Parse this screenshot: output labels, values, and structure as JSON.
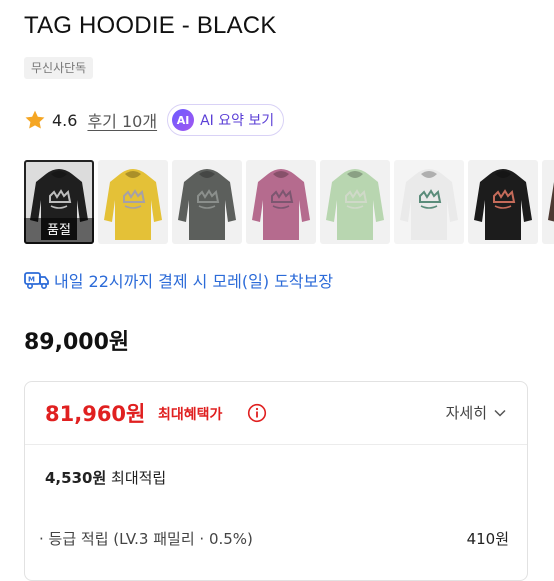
{
  "product": {
    "title": "TAG HOODIE - BLACK",
    "badge": "무신사단독",
    "rating": "4.6",
    "reviews": "후기 10개",
    "ai_badge": "AI",
    "ai_summary": "AI 요약 보기"
  },
  "swatches": [
    {
      "name": "black",
      "color": "#1f1f1f",
      "print": "#bdbdbd",
      "soldout": "품절",
      "bg": "#dcdcdc"
    },
    {
      "name": "yellow",
      "color": "#e4c137",
      "print": "#a5a0a8",
      "bg": "#f1f1f1"
    },
    {
      "name": "charcoal",
      "color": "#5c5f5c",
      "print": "#8b8f8c",
      "bg": "#f1f1f1"
    },
    {
      "name": "mauve",
      "color": "#b56b8e",
      "print": "#7c5670",
      "bg": "#f1f1f1"
    },
    {
      "name": "mint",
      "color": "#b8d6b0",
      "print": "#cfd9c8",
      "bg": "#f1f1f1"
    },
    {
      "name": "white",
      "color": "#eaeaea",
      "print": "#5a8c7a",
      "bg": "#f4f4f4"
    },
    {
      "name": "black-2",
      "color": "#1c1c1c",
      "print": "#c56b5a",
      "bg": "#f1f1f1"
    },
    {
      "name": "brown",
      "color": "#4e3a33",
      "print": "#8a6a5c",
      "bg": "#f1f1f1"
    }
  ],
  "delivery": {
    "text": "내일 22시까지 결제 시 모레(일) 도착보장",
    "color": "#2c6bd8"
  },
  "price": {
    "original": "89,000원"
  },
  "benefit": {
    "max_price": "81,960원",
    "label": "최대혜택가",
    "detail": "자세히",
    "points_amount": "4,530원",
    "points_label": "최대적립",
    "grade_label": "· 등급 적립 (LV.3 패밀리 · 0.5%)",
    "grade_amount": "410원",
    "accent": "#e02020"
  }
}
